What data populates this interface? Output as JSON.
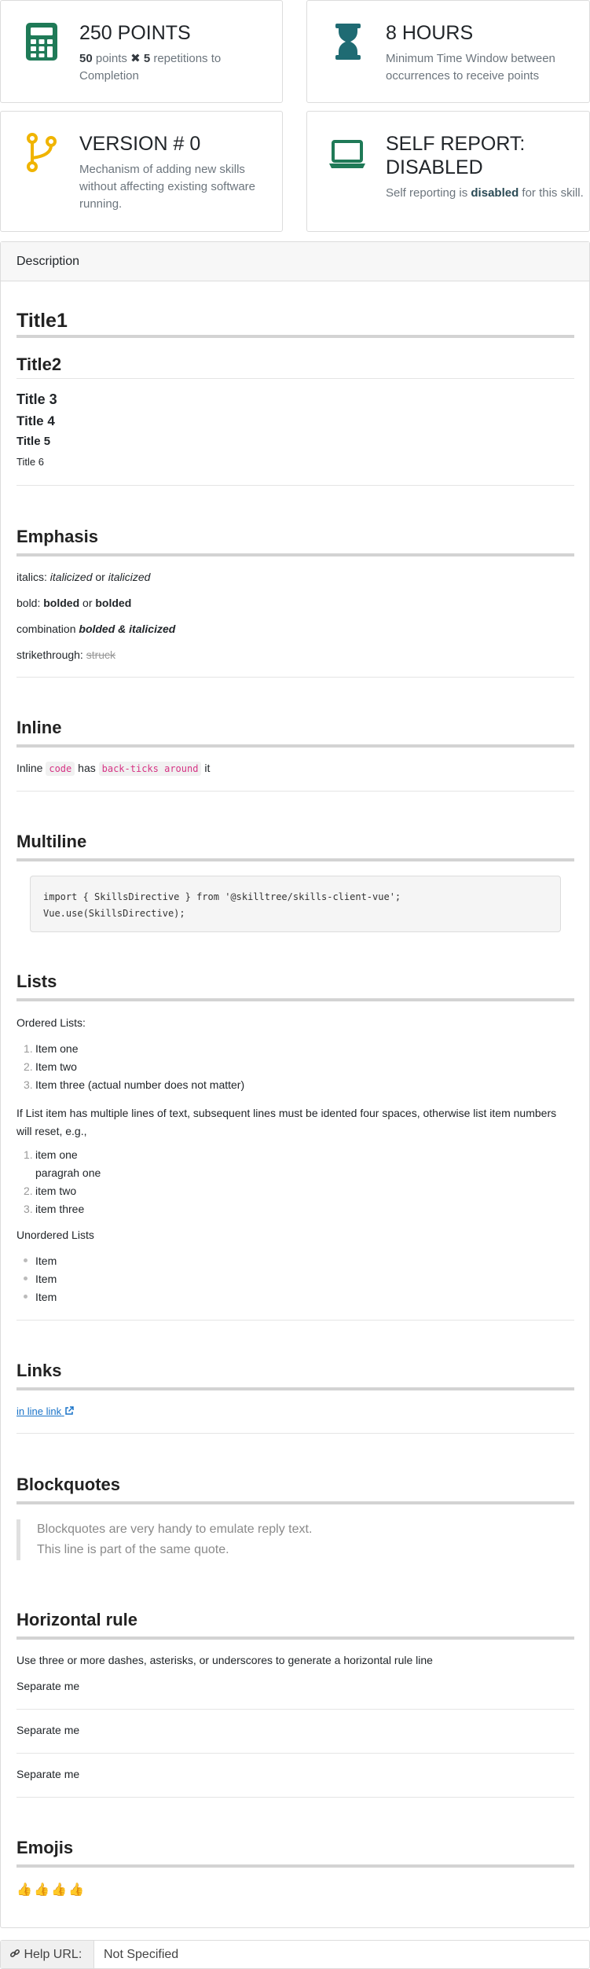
{
  "cards": {
    "points": {
      "title": "250 POINTS",
      "points": "50",
      "points_word": "points",
      "times": "✖",
      "reps": "5",
      "rest": "repetitions to Completion"
    },
    "hours": {
      "title": "8 HOURS",
      "sub": "Minimum Time Window between occurrences to receive points"
    },
    "version": {
      "title": "VERSION # 0",
      "sub": "Mechanism of adding new skills without affecting existing software running."
    },
    "self_report": {
      "title": "SELF REPORT: DISABLED",
      "pre": "Self reporting is",
      "strong": "disabled",
      "post": "for this skill."
    }
  },
  "description": {
    "header": "Description",
    "title1": "Title1",
    "title2": "Title2",
    "title3": "Title 3",
    "title4": "Title 4",
    "title5": "Title 5",
    "title6": "Title 6",
    "emphasis": {
      "heading": "Emphasis",
      "italics_label": "italics:",
      "italics_a": "italicized",
      "or": "or",
      "italics_b": "italicized",
      "bold_label": "bold:",
      "bold_a": "bolded",
      "bold_b": "bolded",
      "combo_label": "combination",
      "combo": "bolded & italicized",
      "strike_label": "strikethrough:",
      "strike": "struck"
    },
    "inline": {
      "heading": "Inline",
      "t1": "Inline",
      "code1": "code",
      "t2": "has",
      "code2": "back-ticks around",
      "t3": "it"
    },
    "multiline": {
      "heading": "Multiline",
      "line1": "import { SkillsDirective } from '@skilltree/skills-client-vue';",
      "line2": "Vue.use(SkillsDirective);"
    },
    "lists": {
      "heading": "Lists",
      "ordered_label": "Ordered Lists:",
      "ordered": [
        "Item one",
        "Item two",
        "Item three (actual number does not matter)"
      ],
      "note": "If List item has multiple lines of text, subsequent lines must be idented four spaces, otherwise list item numbers will reset, e.g.,",
      "ordered2": [
        "item one",
        "paragrah one",
        "item two",
        "item three"
      ],
      "unordered_label": "Unordered Lists",
      "unordered": [
        "Item",
        "Item",
        "Item"
      ],
      "nums": [
        "1.",
        "2.",
        "3."
      ]
    },
    "links": {
      "heading": "Links",
      "link": "in line link"
    },
    "blockquotes": {
      "heading": "Blockquotes",
      "line1": "Blockquotes are very handy to emulate reply text.",
      "line2": "This line is part of the same quote."
    },
    "hr": {
      "heading": "Horizontal rule",
      "text": "Use three or more dashes, asterisks, or underscores to generate a horizontal rule line",
      "sep": "Separate me"
    },
    "emojis": {
      "heading": "Emojis",
      "thumb": "👍"
    }
  },
  "help": {
    "label": "Help URL:",
    "value": "Not Specified"
  },
  "colors": {
    "accent": "#1f7a57",
    "hourglass": "#1f6b73",
    "git": "#f0b400",
    "link": "#1a73c8"
  }
}
